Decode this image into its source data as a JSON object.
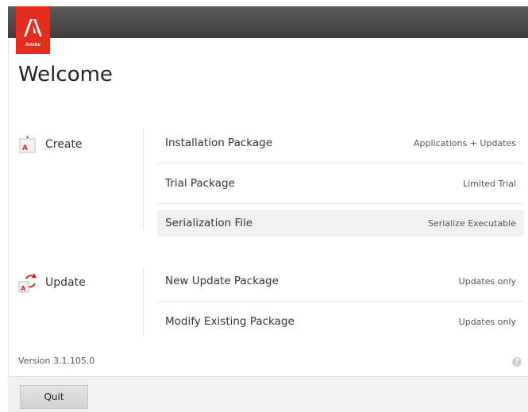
{
  "logo": {
    "text": "Adobe",
    "brand_color": "#e52d1c",
    "icon": "adobe-logo-icon"
  },
  "page_title": "Welcome",
  "sections": {
    "create": {
      "label": "Create",
      "icon": "create-package-icon",
      "items": [
        {
          "name": "Installation Package",
          "description": "Applications + Updates",
          "selected": false
        },
        {
          "name": "Trial Package",
          "description": "Limited Trial",
          "selected": false
        },
        {
          "name": "Serialization File",
          "description": "Serialize Executable",
          "selected": true
        }
      ]
    },
    "update": {
      "label": "Update",
      "icon": "update-package-icon",
      "items": [
        {
          "name": "New Update Package",
          "description": "Updates only",
          "selected": false
        },
        {
          "name": "Modify Existing Package",
          "description": "Updates only",
          "selected": false
        }
      ]
    }
  },
  "version": "Version 3.1.105.0",
  "help_icon": "help-icon",
  "quit_label": "Quit"
}
